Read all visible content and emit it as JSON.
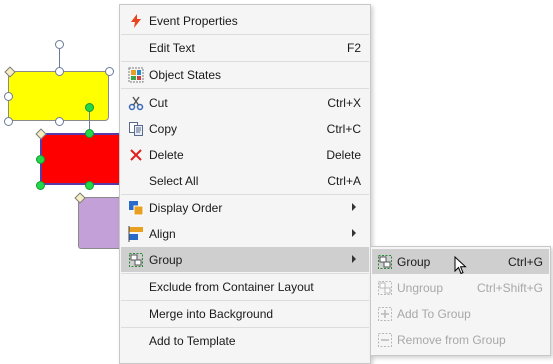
{
  "colors": {
    "shape_yellow": "#ffff00",
    "shape_red": "#ff0000",
    "shape_purple": "#c4a0d8",
    "menu_bg": "#f5f5f5",
    "highlight": "#cfcfcf",
    "disabled_text": "#a8a8a8",
    "handle_green": "#22d84a"
  },
  "context_menu": {
    "items": [
      {
        "label": "Event Properties",
        "shortcut": "",
        "icon": "lightning-icon"
      },
      {
        "label": "Edit Text",
        "shortcut": "F2",
        "icon": ""
      },
      {
        "label": "Object States",
        "shortcut": "",
        "icon": "object-states-icon"
      },
      {
        "label": "Cut",
        "shortcut": "Ctrl+X",
        "icon": "scissors-icon"
      },
      {
        "label": "Copy",
        "shortcut": "Ctrl+C",
        "icon": "copy-icon"
      },
      {
        "label": "Delete",
        "shortcut": "Delete",
        "icon": "red-x-icon"
      },
      {
        "label": "Select All",
        "shortcut": "Ctrl+A",
        "icon": ""
      },
      {
        "label": "Display Order",
        "shortcut": "",
        "icon": "display-order-icon",
        "submenu": true
      },
      {
        "label": "Align",
        "shortcut": "",
        "icon": "align-icon",
        "submenu": true
      },
      {
        "label": "Group",
        "shortcut": "",
        "icon": "group-icon",
        "submenu": true,
        "highlighted": true
      },
      {
        "label": "Exclude from Container Layout",
        "shortcut": "",
        "icon": ""
      },
      {
        "label": "Merge into Background",
        "shortcut": "",
        "icon": ""
      },
      {
        "label": "Add to Template",
        "shortcut": "",
        "icon": ""
      }
    ]
  },
  "group_submenu": {
    "items": [
      {
        "label": "Group",
        "shortcut": "Ctrl+G",
        "enabled": true,
        "highlighted": true,
        "icon": "group-icon"
      },
      {
        "label": "Ungroup",
        "shortcut": "Ctrl+Shift+G",
        "enabled": false,
        "icon": "ungroup-icon"
      },
      {
        "label": "Add To Group",
        "shortcut": "",
        "enabled": false,
        "icon": "add-to-group-icon"
      },
      {
        "label": "Remove from Group",
        "shortcut": "",
        "enabled": false,
        "icon": "remove-from-group-icon"
      }
    ]
  }
}
